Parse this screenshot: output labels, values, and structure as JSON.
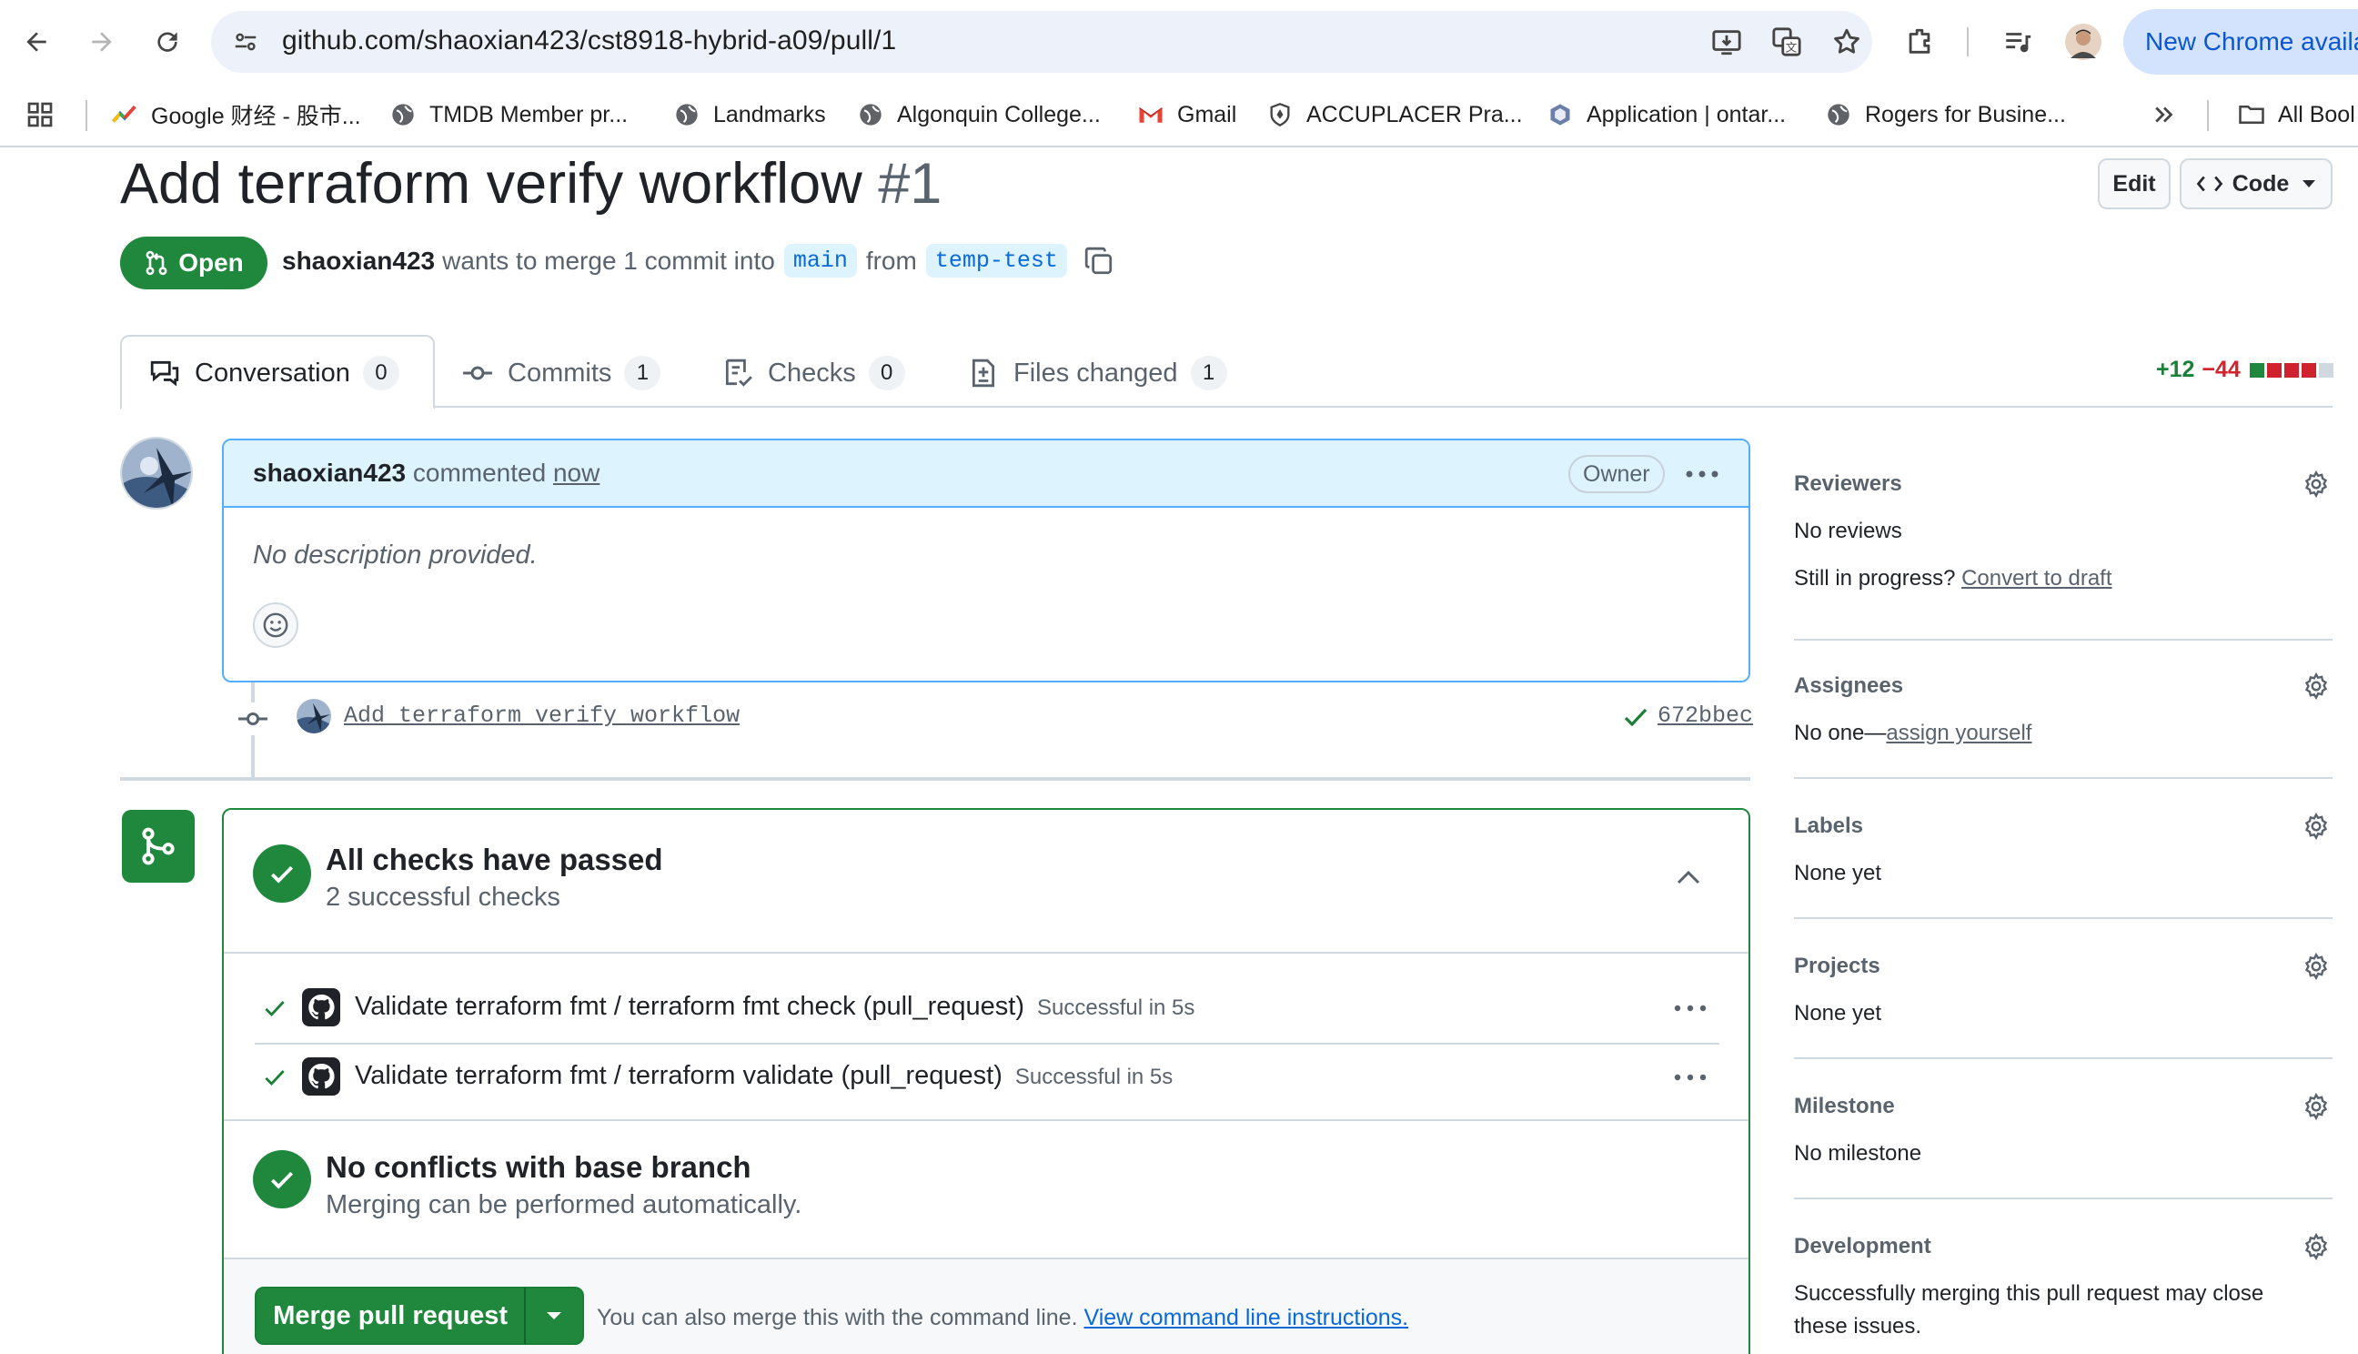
{
  "browser": {
    "url": "github.com/shaoxian423/cst8918-hybrid-a09/pull/1",
    "new_chrome_label": "New Chrome availa",
    "bookmarks": [
      {
        "label": "Google 财经 - 股市...",
        "icon": "google-finance-icon"
      },
      {
        "label": "TMDB Member pr...",
        "icon": "globe-icon"
      },
      {
        "label": "Landmarks",
        "icon": "globe-icon"
      },
      {
        "label": "Algonquin College...",
        "icon": "globe-icon"
      },
      {
        "label": "Gmail",
        "icon": "gmail-icon"
      },
      {
        "label": "ACCUPLACER Pra...",
        "icon": "shield-icon"
      },
      {
        "label": "Application | ontar...",
        "icon": "hexagon-icon"
      },
      {
        "label": "Rogers for Busine...",
        "icon": "globe-icon"
      }
    ],
    "all_bookmarks_label": "All Bool"
  },
  "pr": {
    "title": "Add terraform verify workflow",
    "number": "#1",
    "edit_label": "Edit",
    "code_label": "Code",
    "state": "Open",
    "author": "shaoxian423",
    "merge_text": "wants to merge 1 commit into",
    "base_branch": "main",
    "from_text": "from",
    "head_branch": "temp-test"
  },
  "tabs": [
    {
      "label": "Conversation",
      "count": "0",
      "icon": "comment-discussion-icon"
    },
    {
      "label": "Commits",
      "count": "1",
      "icon": "git-commit-icon"
    },
    {
      "label": "Checks",
      "count": "0",
      "icon": "checklist-icon"
    },
    {
      "label": "Files changed",
      "count": "1",
      "icon": "file-diff-icon"
    }
  ],
  "diffstat": {
    "additions": "+12",
    "deletions": "−44"
  },
  "comment": {
    "author": "shaoxian423",
    "action": "commented",
    "time": "now",
    "badge": "Owner",
    "body": "No description provided."
  },
  "commit": {
    "message": "Add terraform verify workflow",
    "sha": "672bbec"
  },
  "merge_box": {
    "checks_title": "All checks have passed",
    "checks_sub": "2 successful checks",
    "checks": [
      {
        "name": "Validate terraform fmt / terraform fmt check (pull_request)",
        "status": "Successful in 5s"
      },
      {
        "name": "Validate terraform fmt / terraform validate (pull_request)",
        "status": "Successful in 5s"
      }
    ],
    "conflicts_title": "No conflicts with base branch",
    "conflicts_sub": "Merging can be performed automatically.",
    "merge_button": "Merge pull request",
    "note": "You can also merge this with the command line.",
    "note_link": "View command line instructions."
  },
  "sidebar": {
    "reviewers": {
      "title": "Reviewers",
      "value": "No reviews",
      "progress_text": "Still in progress?",
      "progress_link": "Convert to draft"
    },
    "assignees": {
      "title": "Assignees",
      "value": "No one—",
      "link": "assign yourself"
    },
    "labels": {
      "title": "Labels",
      "value": "None yet"
    },
    "projects": {
      "title": "Projects",
      "value": "None yet"
    },
    "milestone": {
      "title": "Milestone",
      "value": "No milestone"
    },
    "development": {
      "title": "Development",
      "line1": "Successfully merging this pull request may close",
      "line2": "these issues."
    }
  },
  "colors": {
    "accent_green": "#1f883d",
    "link_blue": "#0969da",
    "muted": "#59636e",
    "chrome_tint": "#d3e3fd"
  }
}
